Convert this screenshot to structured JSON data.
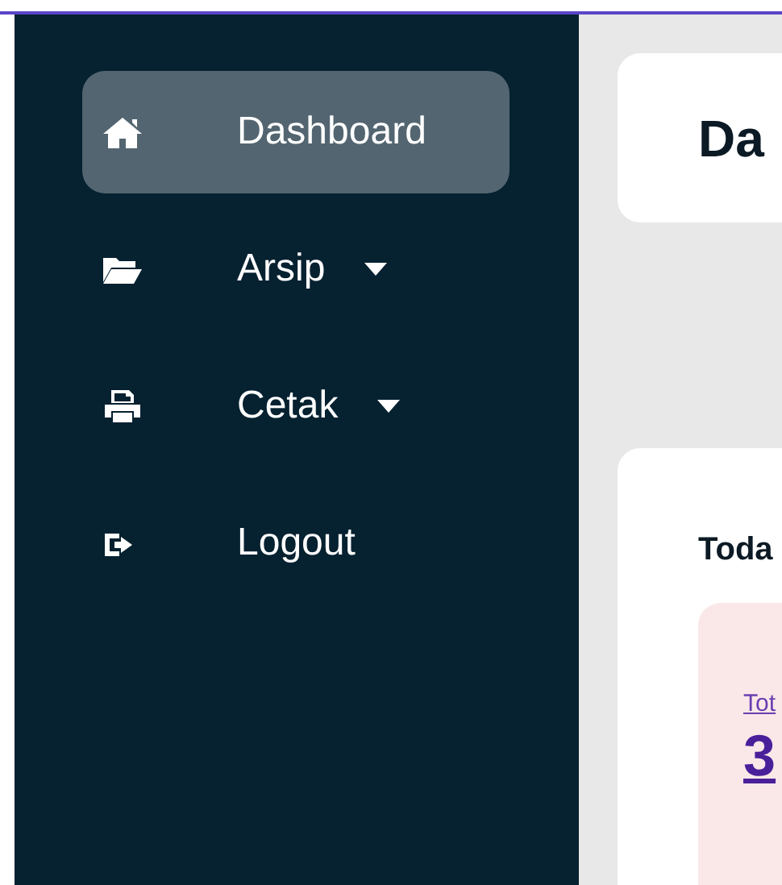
{
  "sidebar": {
    "items": [
      {
        "kind": "home",
        "label": "Dashboard",
        "selected": true,
        "has_submenu": false
      },
      {
        "kind": "folder",
        "label": "Arsip",
        "selected": false,
        "has_submenu": true
      },
      {
        "kind": "print",
        "label": "Cetak",
        "selected": false,
        "has_submenu": true
      },
      {
        "kind": "logout",
        "label": "Logout",
        "selected": false,
        "has_submenu": false
      }
    ]
  },
  "header": {
    "title": "Da"
  },
  "panel": {
    "title": "Toda",
    "stat": {
      "label": "Tot",
      "value": "3"
    }
  }
}
